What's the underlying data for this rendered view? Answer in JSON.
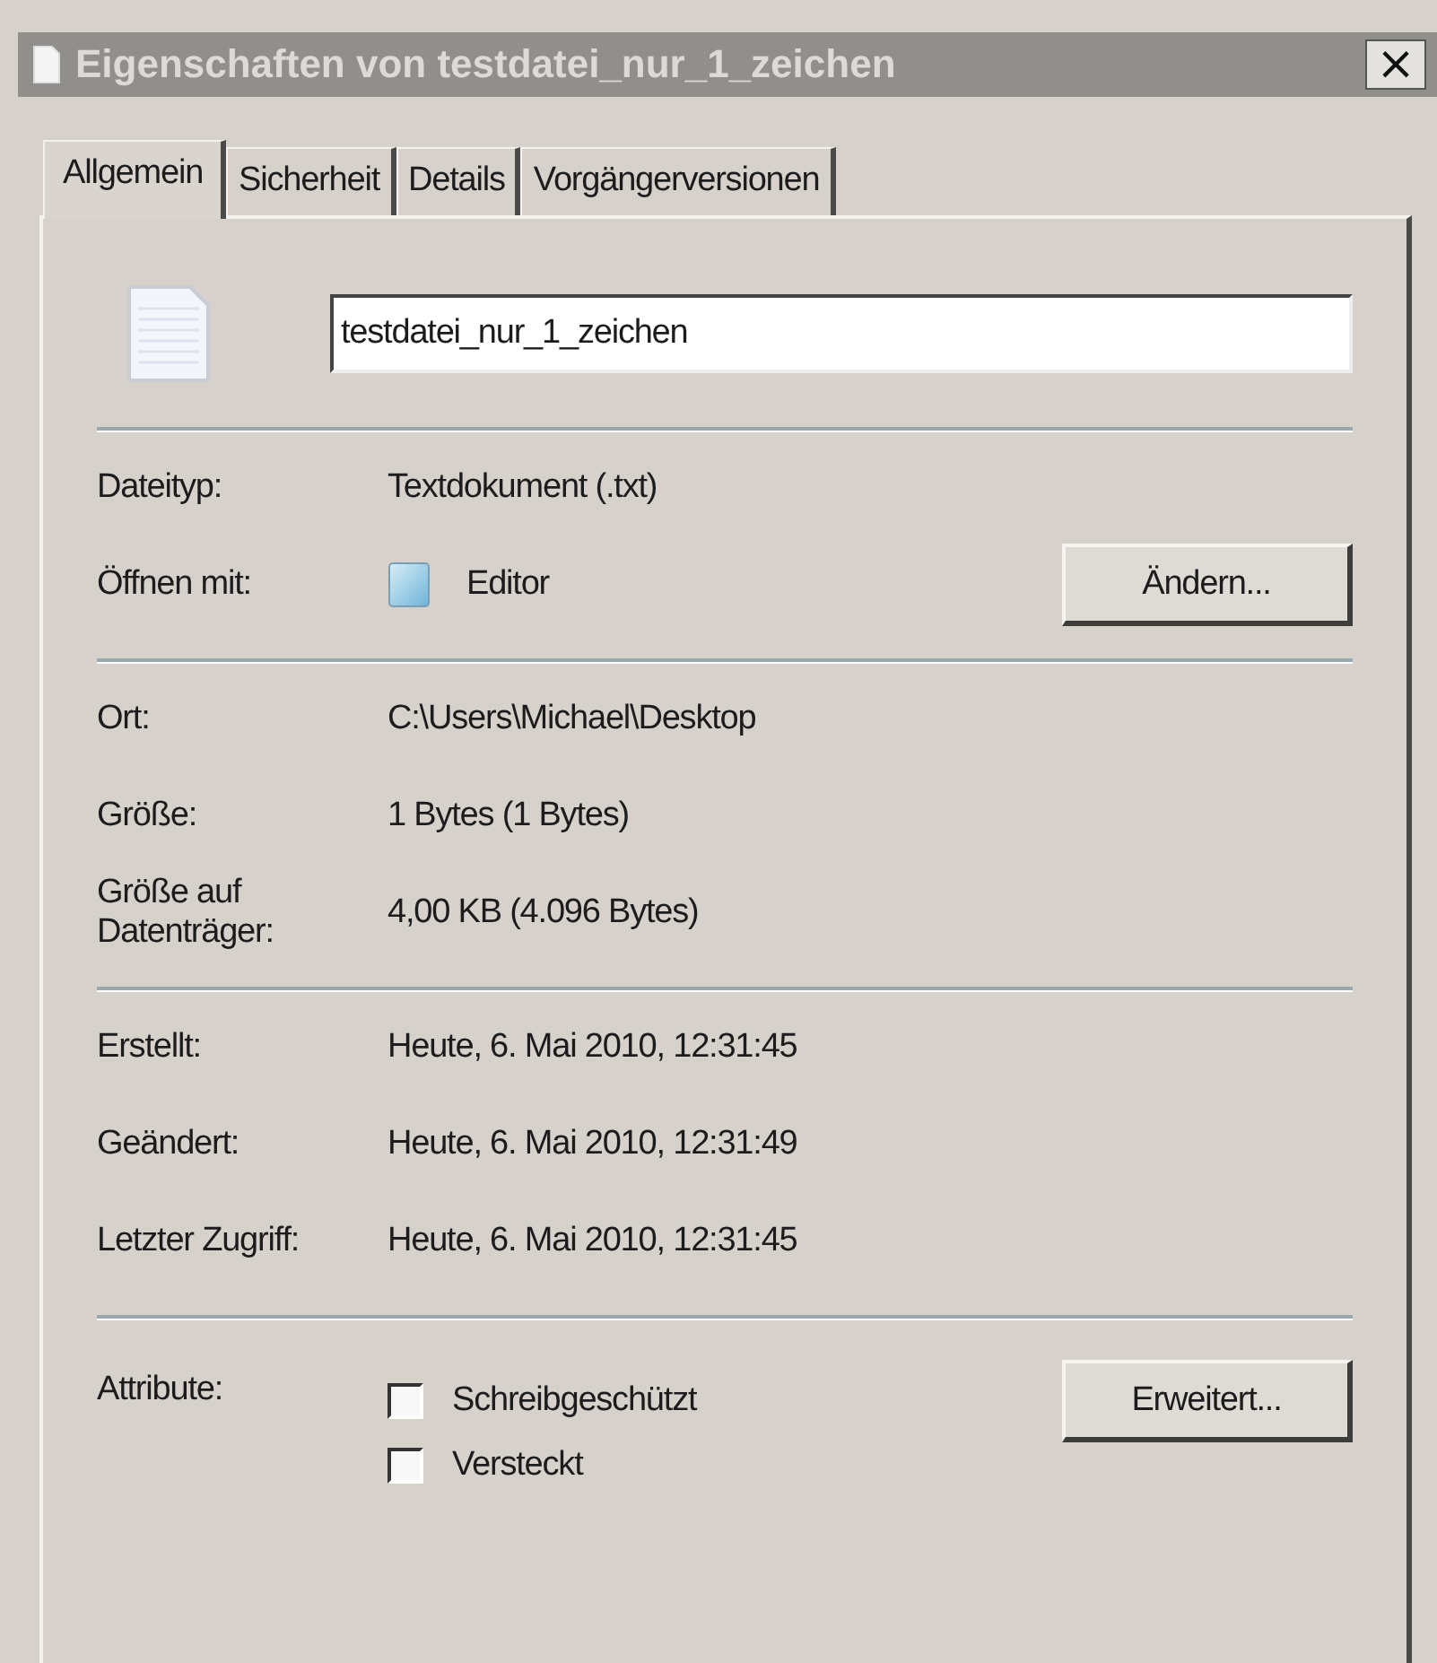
{
  "window": {
    "title": "Eigenschaften von testdatei_nur_1_zeichen",
    "close": "×"
  },
  "tabs": [
    {
      "label": "Allgemein",
      "selected": true
    },
    {
      "label": "Sicherheit",
      "selected": false
    },
    {
      "label": "Details",
      "selected": false
    },
    {
      "label": "Vorgängerversionen",
      "selected": false
    }
  ],
  "name_field": {
    "value": "testdatei_nur_1_zeichen"
  },
  "sections": [
    {
      "rows": [
        {
          "kind": "text",
          "label": "Dateityp:",
          "value": "Textdokument (.txt)"
        },
        {
          "kind": "app",
          "label": "Öffnen mit:",
          "value": "Editor",
          "button": "Ändern..."
        }
      ]
    },
    {
      "rows": [
        {
          "kind": "text",
          "label": "Ort:",
          "value": "C:\\Users\\Michael\\Desktop"
        },
        {
          "kind": "text",
          "label": "Größe:",
          "value": "1 Bytes (1 Bytes)"
        },
        {
          "kind": "text",
          "label": "Größe auf Datenträger:",
          "value": "4,00 KB (4.096 Bytes)"
        }
      ]
    },
    {
      "rows": [
        {
          "kind": "text",
          "label": "Erstellt:",
          "value": "Heute, 6. Mai 2010, 12:31:45"
        },
        {
          "kind": "text",
          "label": "Geändert:",
          "value": "Heute, 6. Mai 2010, 12:31:49"
        },
        {
          "kind": "text",
          "label": "Letzter Zugriff:",
          "value": "Heute, 6. Mai 2010, 12:31:45"
        }
      ]
    },
    {
      "rows": [
        {
          "kind": "attributes",
          "label": "Attribute:",
          "button": "Erweitert...",
          "checkboxes": [
            {
              "label": "Schreibgeschützt",
              "checked": false
            },
            {
              "label": "Versteckt",
              "checked": false
            }
          ]
        }
      ]
    }
  ]
}
